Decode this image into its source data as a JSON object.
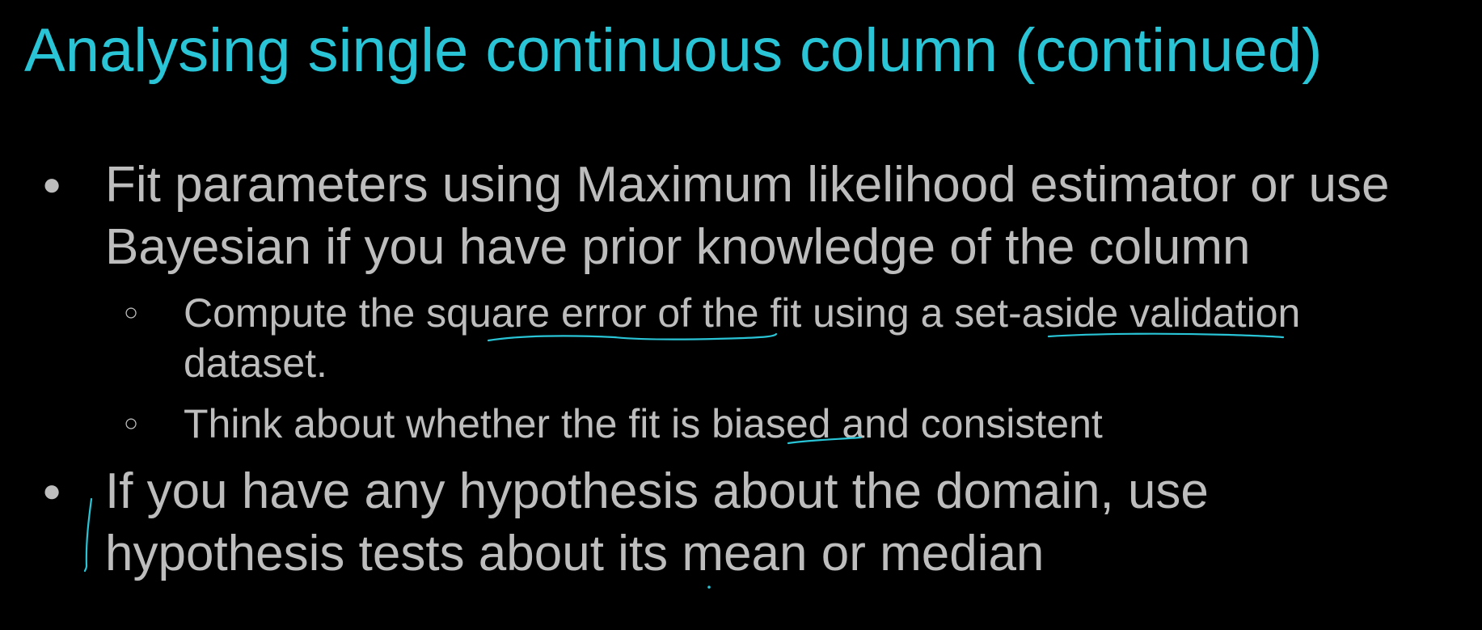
{
  "slide": {
    "title": "Analysing single continuous column (continued)",
    "bullets": [
      {
        "marker": "●",
        "lines": [
          "Fit parameters using Maximum likelihood estimator or use",
          "Bayesian if you have prior knowledge of the column"
        ]
      },
      {
        "marker": "●",
        "lines": [
          "If you have any hypothesis about the domain, use",
          "hypothesis tests about its mean or median"
        ]
      }
    ],
    "sub_bullets": [
      {
        "marker": "○",
        "lines": [
          "Compute the square error of the fit using a set-aside validation",
          "dataset."
        ]
      },
      {
        "marker": "○",
        "lines": [
          "Think about whether the fit is biased and consistent"
        ]
      }
    ]
  },
  "colors": {
    "background": "#000000",
    "title": "#29c4d6",
    "body_text": "#bdbdbd",
    "annotation_ink": "#29c4d6"
  }
}
